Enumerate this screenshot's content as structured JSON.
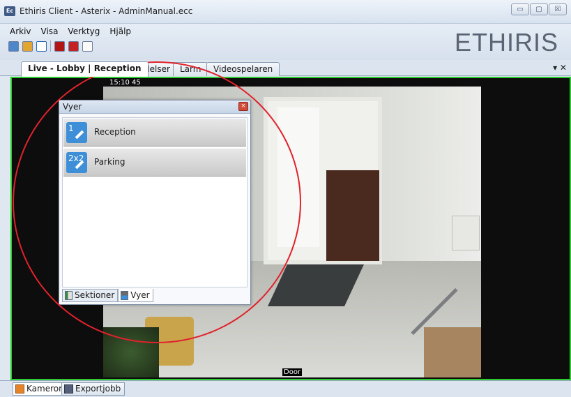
{
  "window": {
    "app_icon": "Ec",
    "title": "Ethiris Client - Asterix - AdminManual.ecc",
    "minimize": "▭",
    "maximize": "▢",
    "close": "☒"
  },
  "menu": [
    "Arkiv",
    "Visa",
    "Verktyg",
    "Hjälp"
  ],
  "toolbar": {
    "icons": [
      "settings-icon",
      "save-icon",
      "refresh-icon",
      "record-icon",
      "power-icon",
      "export-icon"
    ]
  },
  "brand": "ETHIRIS",
  "tabs": [
    {
      "label": "Live - Lobby | Reception",
      "active": true
    },
    {
      "label": "Händelser",
      "active": false
    },
    {
      "label": "Larm",
      "active": false
    },
    {
      "label": "Videospelaren",
      "active": false
    }
  ],
  "tab_controls": "▾ ✕",
  "camera": {
    "timestamp": "15:10 45",
    "label": "Door"
  },
  "views_panel": {
    "title": "Vyer",
    "close": "×",
    "items": [
      {
        "icon_text": "1",
        "label": "Reception"
      },
      {
        "icon_text": "2x2",
        "label": "Parking"
      }
    ],
    "tabs": [
      {
        "label": "Sektioner",
        "active": false
      },
      {
        "label": "Vyer",
        "active": true
      }
    ]
  },
  "bottom_tabs": [
    {
      "label": "Kameror",
      "active": true
    },
    {
      "label": "Exportjobb",
      "active": false
    }
  ],
  "colors": {
    "active_border": "#2ccc30",
    "annotation": "#e0222c",
    "brand": "#5a6474"
  }
}
